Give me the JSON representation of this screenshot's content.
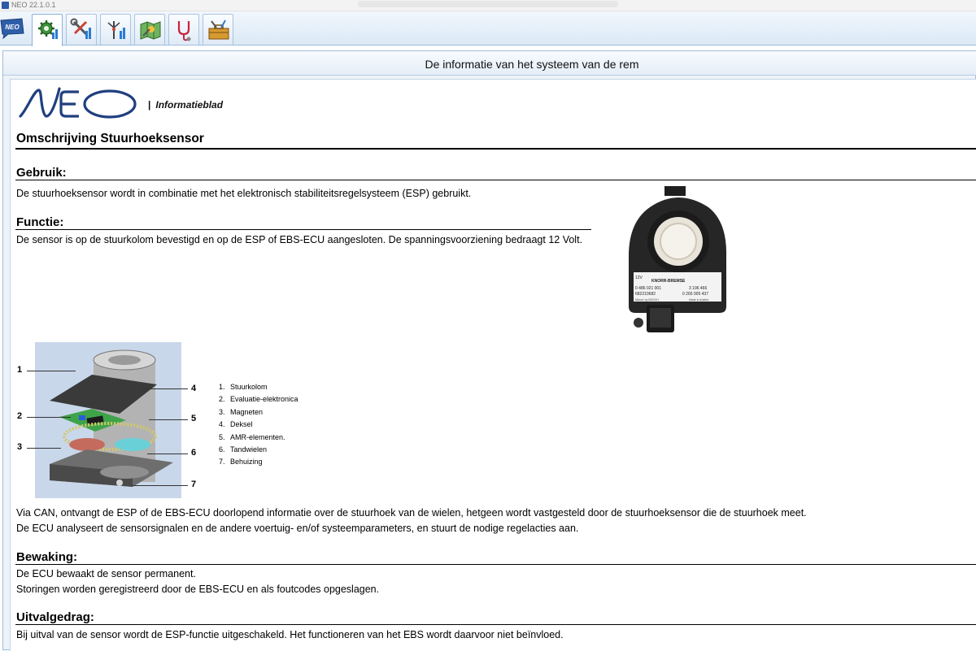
{
  "window": {
    "app_title": "NEO 22.1.0.1"
  },
  "toolbar": {
    "neo_button_label": "NEO",
    "buttons": [
      "gear-tools-icon",
      "wrench-screwdriver-icon",
      "antenna-signal-icon",
      "map-tools-icon",
      "stethoscope-icon",
      "toolbox-icon"
    ]
  },
  "frame": {
    "title": "De informatie van het systeem van de rem"
  },
  "doc": {
    "brand": {
      "logo_text": "NEO",
      "separator": "|",
      "subtitle": "Informatieblad"
    },
    "title": "Omschrijving Stuurhoeksensor",
    "sections": {
      "gebruik": {
        "heading": "Gebruik:",
        "text": "De stuurhoeksensor wordt in combinatie met het elektronisch stabiliteitsregelsysteem (ESP) gebruikt."
      },
      "functie": {
        "heading": "Functie:",
        "text": "De sensor is op de stuurkolom bevestigd en op de ESP of EBS-ECU aangesloten. De spanningsvoorziening bedraagt 12 Volt.",
        "text2": "Via CAN, ontvangt de ESP of de EBS-ECU doorlopend informatie over de stuurhoek van de wielen, hetgeen wordt vastgesteld door de stuurhoeksensor die de stuurhoek meet.",
        "text3": "De ECU analyseert de sensorsignalen en de andere voertuig- en/of systeemparameters, en stuurt de nodige regelacties aan."
      },
      "bewaking": {
        "heading": "Bewaking:",
        "text1": "De ECU bewaakt de sensor permanent.",
        "text2": "Storingen worden geregistreerd door de EBS-ECU en als foutcodes opgeslagen."
      },
      "uitval": {
        "heading": "Uitvalgedrag:",
        "text": "Bij uitval van de sensor wordt de ESP-functie uitgeschakeld. Het functioneren van het EBS wordt daarvoor niet beïnvloed."
      }
    },
    "photo_label": {
      "voltage": "12V",
      "brand": "KNORR-BREMSE",
      "line1a": "0 486 021 001",
      "line1b": "3 196 466",
      "line2a": "682210682",
      "line2b": "0 265 005 437",
      "line3a": "Manuf. by BOSCH",
      "line3b": "Made in Austria"
    },
    "diagram_callouts": [
      "1",
      "2",
      "3",
      "4",
      "5",
      "6",
      "7"
    ],
    "legend": [
      {
        "num": "1.",
        "label": "Stuurkolom"
      },
      {
        "num": "2.",
        "label": "Evaluatie-elektronica"
      },
      {
        "num": "3.",
        "label": "Magneten"
      },
      {
        "num": "4.",
        "label": "Deksel"
      },
      {
        "num": "5.",
        "label": "AMR-elementen."
      },
      {
        "num": "6.",
        "label": "Tandwielen"
      },
      {
        "num": "7.",
        "label": "Behuizing"
      }
    ]
  }
}
